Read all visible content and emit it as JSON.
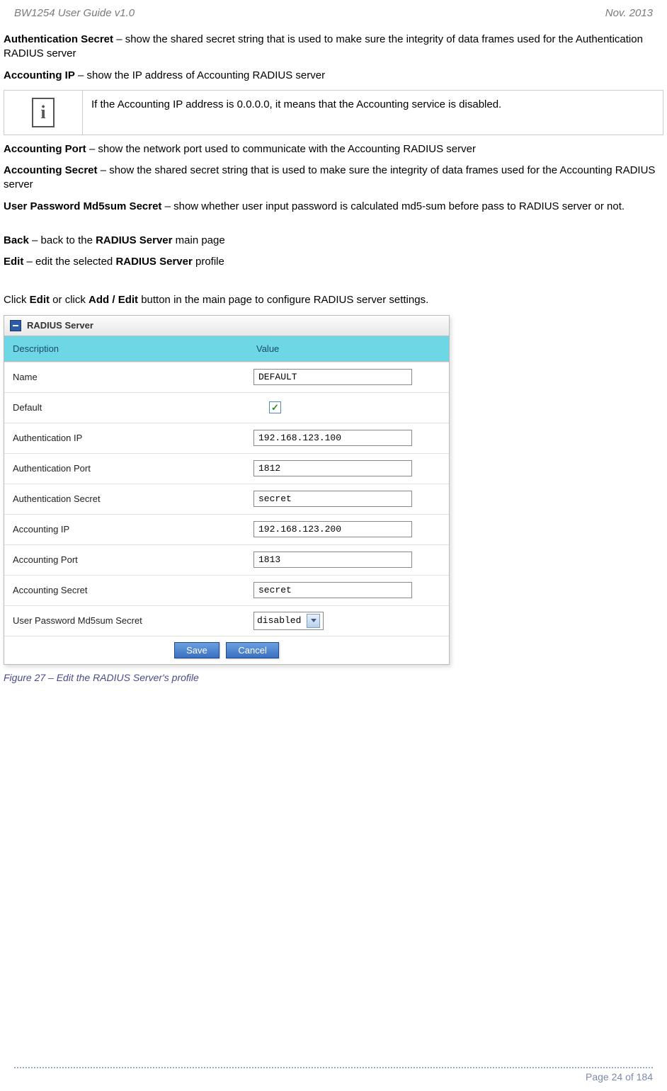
{
  "header": {
    "doc_title": "BW1254 User Guide v1.0",
    "doc_date": "Nov.  2013"
  },
  "text": {
    "auth_secret_label": "Authentication Secret",
    "auth_secret_desc": " – show the shared secret string that is used to make sure the integrity of data frames used for the Authentication RADIUS server",
    "acct_ip_label": "Accounting IP",
    "acct_ip_desc": " – show the IP address of Accounting RADIUS server",
    "info_note": "If the Accounting IP address is 0.0.0.0, it means that the Accounting service is disabled.",
    "acct_port_label": "Accounting Port",
    "acct_port_desc": " – show the network port used to communicate with the Accounting RADIUS server",
    "acct_secret_label": "Accounting Secret",
    "acct_secret_desc": " – show the shared secret string that is used to make sure the integrity of data frames used for the Accounting RADIUS server",
    "md5_label": "User Password Md5sum Secret",
    "md5_desc": " – show whether user input password is calculated md5-sum before pass to RADIUS server or not.",
    "back_label": "Back",
    "back_desc_prefix": " – back to the ",
    "back_desc_bold": "RADIUS Server",
    "back_desc_suffix": " main page",
    "edit_label": "Edit",
    "edit_desc_prefix": " – edit the selected ",
    "edit_desc_bold": "RADIUS Server",
    "edit_desc_suffix": " profile",
    "click_prefix": "Click ",
    "click_edit": "Edit",
    "click_mid": " or click ",
    "click_addedit": "Add / Edit",
    "click_suffix": " button in the main page to configure RADIUS server settings."
  },
  "panel": {
    "title": "RADIUS Server",
    "col_desc": "Description",
    "col_val": "Value",
    "rows": {
      "name": {
        "label": "Name",
        "value": "DEFAULT"
      },
      "default": {
        "label": "Default",
        "checked": true
      },
      "auth_ip": {
        "label": "Authentication IP",
        "value": "192.168.123.100"
      },
      "auth_port": {
        "label": "Authentication Port",
        "value": "1812"
      },
      "auth_secret": {
        "label": "Authentication Secret",
        "value": "secret"
      },
      "acct_ip": {
        "label": "Accounting IP",
        "value": "192.168.123.200"
      },
      "acct_port": {
        "label": "Accounting Port",
        "value": "1813"
      },
      "acct_secret": {
        "label": "Accounting Secret",
        "value": "secret"
      },
      "md5": {
        "label": "User Password Md5sum Secret",
        "value": "disabled"
      }
    },
    "save_btn": "Save",
    "cancel_btn": "Cancel"
  },
  "caption": "Figure 27 – Edit the RADIUS Server's profile",
  "footer": {
    "page": "Page 24 of 184"
  }
}
